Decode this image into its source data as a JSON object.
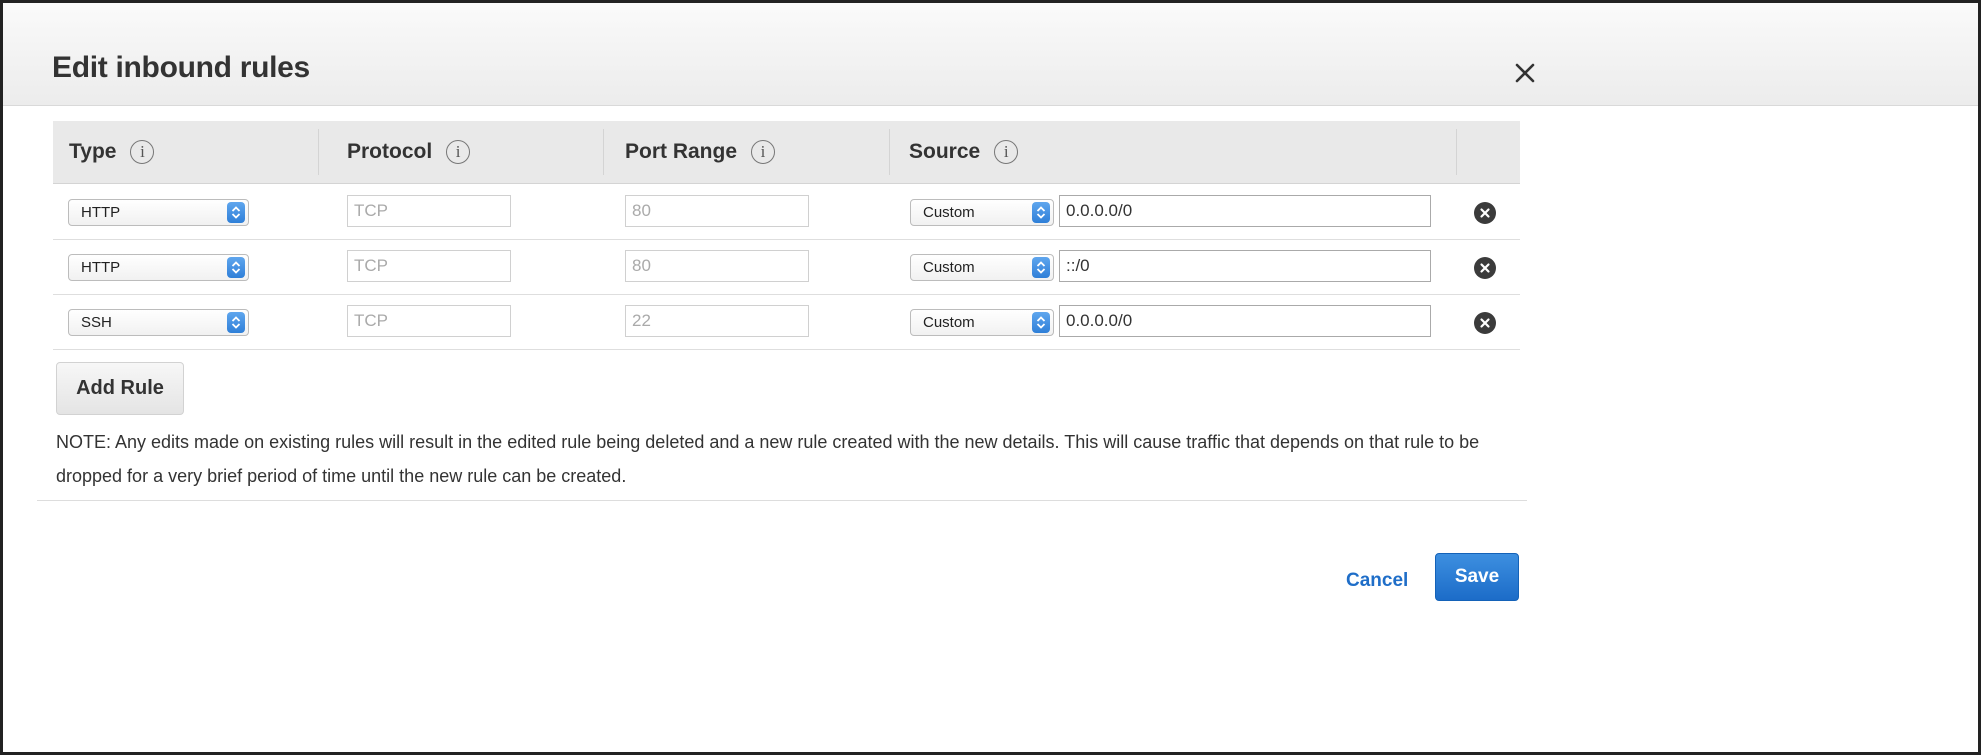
{
  "dialog": {
    "title": "Edit inbound rules",
    "close_label": "×"
  },
  "table": {
    "headers": {
      "type": "Type",
      "protocol": "Protocol",
      "port_range": "Port Range",
      "source": "Source",
      "info_glyph": "i"
    },
    "rows": [
      {
        "type": "HTTP",
        "protocol": "TCP",
        "port_range": "80",
        "source_mode": "Custom",
        "source_value": "0.0.0.0/0"
      },
      {
        "type": "HTTP",
        "protocol": "TCP",
        "port_range": "80",
        "source_mode": "Custom",
        "source_value": "::/0"
      },
      {
        "type": "SSH",
        "protocol": "TCP",
        "port_range": "22",
        "source_mode": "Custom",
        "source_value": "0.0.0.0/0"
      }
    ]
  },
  "actions": {
    "add_rule": "Add Rule",
    "cancel": "Cancel",
    "save": "Save"
  },
  "note": "NOTE: Any edits made on existing rules will result in the edited rule being deleted and a new rule created with the new details. This will cause traffic that depends on that rule to be dropped for a very brief period of time until the new rule can be created.",
  "colors": {
    "primary": "#1c6cc8",
    "link": "#1f6ec8",
    "stepper": "#2f7fd8",
    "remove_icon": "#3b3b3b"
  },
  "icons": {
    "close": "close-icon",
    "info": "info-icon",
    "stepper": "chevron-up-down-icon",
    "remove": "remove-circle-icon"
  }
}
